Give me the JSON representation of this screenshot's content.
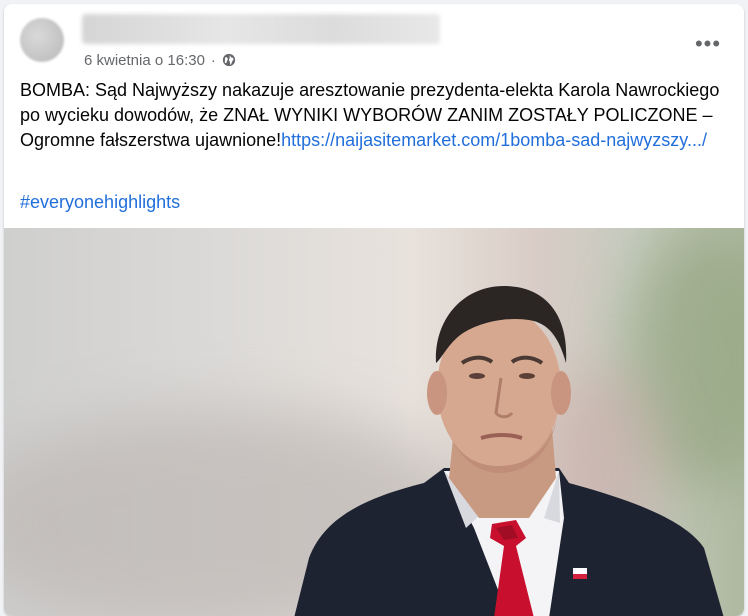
{
  "post": {
    "timestamp": "6 kwietnia o 16:30",
    "separator": "·",
    "body_text": "BOMBA: Sąd Najwyższy nakazuje aresztowanie prezydenta-elekta Karola Nawrockiego po wycieku dowodów, że ZNAŁ WYNIKI WYBORÓW ZANIM ZOSTAŁY POLICZONE – Ogromne fałszerstwa ujawnione!",
    "link_text": "https://naijasitemarket.com/1bomba-sad-najwyzszy.../",
    "hashtag": "#everyonehighlights",
    "more_label": "•••",
    "visibility_icon": "globe-icon",
    "link_color": "#216fdb"
  }
}
